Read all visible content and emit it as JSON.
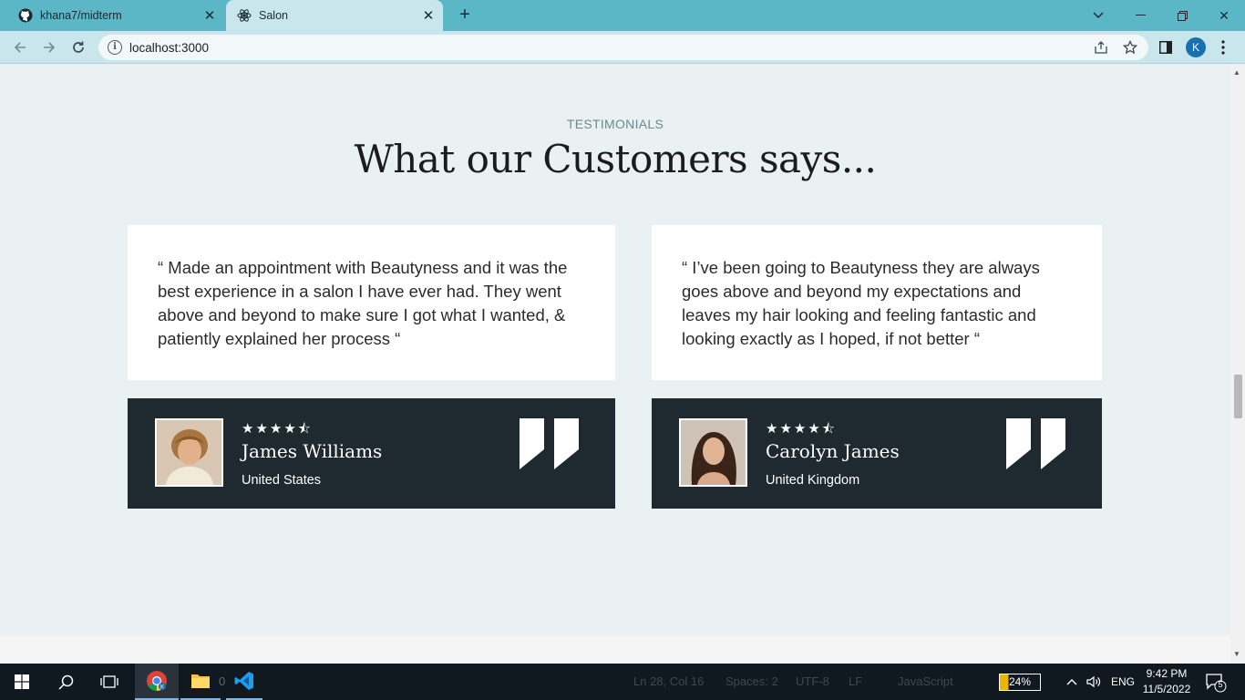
{
  "browser": {
    "tabs": [
      {
        "title": "khana7/midterm",
        "icon": "github-icon",
        "active": false
      },
      {
        "title": "Salon",
        "icon": "react-icon",
        "active": true
      }
    ],
    "url": "localhost:3000",
    "profile_initial": "K"
  },
  "section": {
    "eyebrow": "TESTIMONIALS",
    "headline": "What our Customers says..."
  },
  "testimonials": [
    {
      "quote": "“ Made an appointment with Beautyness and it was the best experience in a salon I have ever had. They went above and beyond to make sure I got what I wanted, & patiently explained her process “",
      "rating": 4.5,
      "stars": "★★★★⯪",
      "name": "James Williams",
      "country": "United States"
    },
    {
      "quote": "“ I’ve been going to Beautyness they are always goes above and beyond my expectations and leaves my hair looking and feeling fantastic and looking exactly as I hoped, if not better “",
      "rating": 4.5,
      "stars": "★★★★⯪",
      "name": "Carolyn James",
      "country": "United Kingdom"
    }
  ],
  "taskbar": {
    "status_cursor": "Ln 28, Col 16",
    "status_spaces": "Spaces: 2",
    "status_encoding": "UTF-8",
    "status_eol": "LF",
    "status_language": "JavaScript",
    "explorer_badge": "0",
    "battery": "24%",
    "language": "ENG",
    "time": "9:42 PM",
    "date": "11/5/2022",
    "notifications": "5"
  },
  "colors": {
    "tab_strip": "#5bb6c5",
    "toolbar": "#c8e6ec",
    "page_bg": "#e9f1f3",
    "panel_dark": "#1e2a2f",
    "taskbar": "#101820"
  }
}
